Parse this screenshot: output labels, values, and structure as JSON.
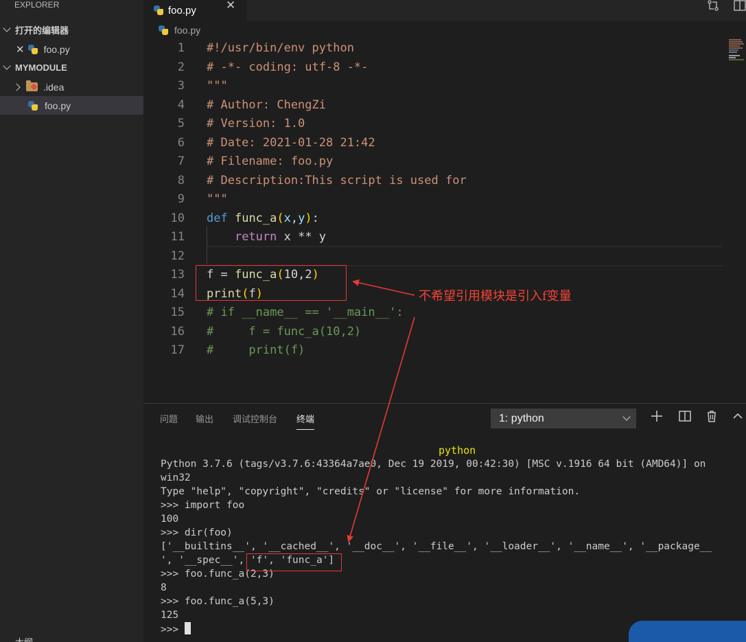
{
  "sidebar": {
    "title": "EXPLORER",
    "open_editors_label": "打开的编辑器",
    "open_editor_file": "foo.py",
    "folder_label": "MYMODULE",
    "idea_folder": ".idea",
    "file": "foo.py",
    "bottom_label": "大纲"
  },
  "tab": {
    "label": "foo.py"
  },
  "breadcrumb": {
    "file": "foo.py"
  },
  "editor": {
    "lines": [
      {
        "n": "1",
        "text": "#!/usr/bin/env python",
        "kind": "str"
      },
      {
        "n": "2",
        "text": "# -*- coding: utf-8 -*-",
        "kind": "str"
      },
      {
        "n": "3",
        "text": "\"\"\"",
        "kind": "str"
      },
      {
        "n": "4",
        "text": "# Author: ChengZi",
        "kind": "str"
      },
      {
        "n": "5",
        "text": "# Version: 1.0",
        "kind": "str"
      },
      {
        "n": "6",
        "text": "# Date: 2021-01-28 21:42",
        "kind": "str"
      },
      {
        "n": "7",
        "text": "# Filename: foo.py",
        "kind": "str"
      },
      {
        "n": "8",
        "text": "# Description:This script is used for",
        "kind": "str"
      },
      {
        "n": "9",
        "text": "\"\"\"",
        "kind": "str"
      },
      {
        "n": "10",
        "text": "",
        "kind": "def"
      },
      {
        "n": "11",
        "text": "",
        "kind": "ret"
      },
      {
        "n": "12",
        "text": "",
        "kind": "plain"
      },
      {
        "n": "13",
        "text": "",
        "kind": "assign"
      },
      {
        "n": "14",
        "text": "",
        "kind": "print"
      },
      {
        "n": "15",
        "text": "# if __name__ == '__main__':",
        "kind": "cmt"
      },
      {
        "n": "16",
        "text": "#     f = func_a(10,2)",
        "kind": "cmt"
      },
      {
        "n": "17",
        "text": "#     print(f)",
        "kind": "cmt"
      }
    ],
    "line10": {
      "kw": "def",
      "fn": "func_a",
      "p1": "(",
      "a": "x",
      "comma": ",",
      "b": "y",
      "p2": ")",
      "colon": ":"
    },
    "line11": {
      "kw": "return",
      "expr": " x ** y"
    },
    "line13": {
      "v": "f",
      "eq": " = ",
      "fn": "func_a",
      "p1": "(",
      "n1": "10",
      "comma": ",",
      "n2": "2",
      "p2": ")"
    },
    "line14": {
      "fn": "print",
      "p1": "(",
      "v": "f",
      "p2": ")"
    }
  },
  "annotation": {
    "text": "不希望引用模块是引入f变量"
  },
  "panel": {
    "tabs": [
      "问题",
      "输出",
      "调试控制台",
      "终端"
    ],
    "terminal_select": "1: python",
    "terminal_title": "python",
    "lines": [
      "Python 3.7.6 (tags/v3.7.6:43364a7ae0, Dec 19 2019, 00:42:30) [MSC v.1916 64 bit (AMD64)] on",
      "win32",
      "Type \"help\", \"copyright\", \"credits\" or \"license\" for more information.",
      ">>> import foo",
      "100",
      ">>> dir(foo)",
      "['__builtins__', '__cached__', '__doc__', '__file__', '__loader__', '__name__', '__package__",
      "', '__spec__', 'f', 'func_a']",
      ">>> foo.func_a(2,3)",
      "8",
      ">>> foo.func_a(5,3)",
      "125"
    ],
    "prompt": ">>> "
  },
  "colors": {
    "annotation_red": "#e53935",
    "python_blue": "#3572a5",
    "python_yellow": "#f0c93a",
    "terminal_title": "#e5e510"
  }
}
